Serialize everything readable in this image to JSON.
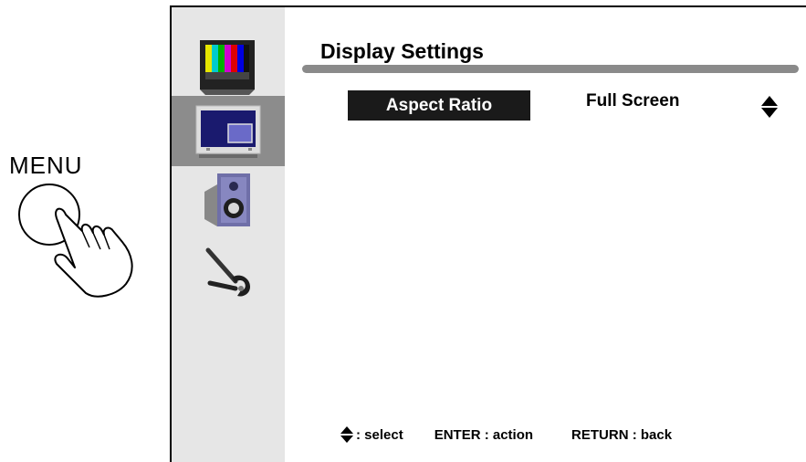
{
  "menu_button": {
    "label": "MENU",
    "icon": "hand-press-icon"
  },
  "sidebar": {
    "items": [
      {
        "name": "picture",
        "icon": "tv-color-bars-icon",
        "active": false
      },
      {
        "name": "display",
        "icon": "tv-display-icon",
        "active": true
      },
      {
        "name": "sound",
        "icon": "speaker-icon",
        "active": false
      },
      {
        "name": "setup",
        "icon": "wrench-icon",
        "active": false
      }
    ]
  },
  "page": {
    "title": "Display Settings"
  },
  "settings": [
    {
      "label": "Aspect Ratio",
      "value": "Full Screen",
      "control_icon": "up-down-arrow-icon",
      "selected": true
    }
  ],
  "footer": {
    "select_label": ": select",
    "enter_label": "ENTER : action",
    "return_label": "RETURN : back"
  },
  "colors": {
    "sidebar_bg": "#e6e6e6",
    "sidebar_active_bg": "#8c8c8c",
    "title_bar": "#8a8a8a",
    "highlight_bg": "#1a1a1a"
  }
}
